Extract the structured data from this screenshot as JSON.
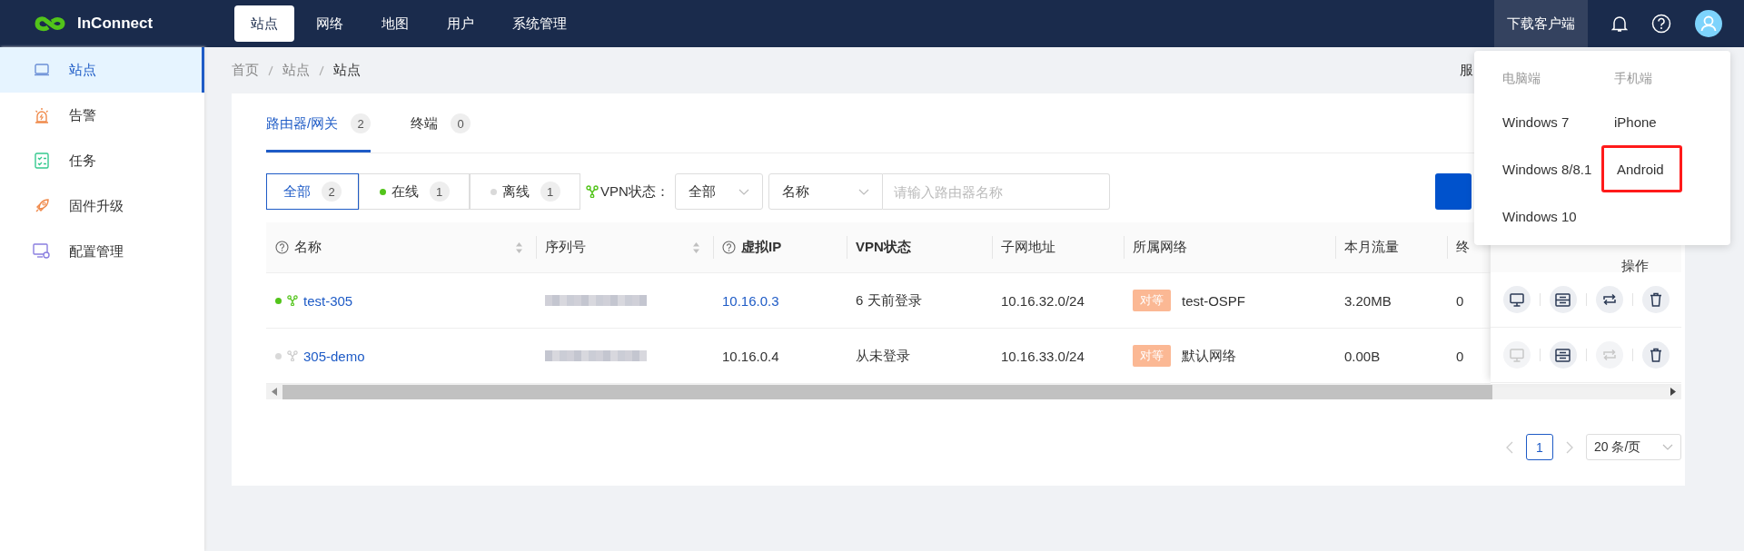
{
  "header": {
    "logo": "InConnect",
    "nav": [
      {
        "label": "站点",
        "selected": true
      },
      {
        "label": "网络",
        "selected": false
      },
      {
        "label": "地图",
        "selected": false
      },
      {
        "label": "用户",
        "selected": false
      },
      {
        "label": "系统管理",
        "selected": false
      }
    ],
    "download": "下载客户端"
  },
  "sidebar": {
    "items": [
      {
        "label": "站点",
        "selected": true
      },
      {
        "label": "告警",
        "selected": false
      },
      {
        "label": "任务",
        "selected": false
      },
      {
        "label": "固件升级",
        "selected": false
      },
      {
        "label": "配置管理",
        "selected": false
      }
    ]
  },
  "breadcrumb": [
    "首页",
    "站点",
    "站点"
  ],
  "breadcrumb_right": "服",
  "tabs": [
    {
      "label": "路由器/网关",
      "count": "2",
      "selected": true
    },
    {
      "label": "终端",
      "count": "0",
      "selected": false
    }
  ],
  "filters": [
    {
      "label": "全部",
      "count": "2",
      "selected": true
    },
    {
      "label": "在线",
      "count": "1",
      "selected": false,
      "color": "#52c41a"
    },
    {
      "label": "离线",
      "count": "1",
      "selected": false,
      "color": "#d9d9d9"
    }
  ],
  "vpn_filter": {
    "label": "VPN状态：",
    "value": "全部"
  },
  "field_select": "名称",
  "search": {
    "placeholder": "请输入路由器名称"
  },
  "table": {
    "columns": [
      {
        "label": "名称",
        "help": true,
        "sortable": true
      },
      {
        "label": "序列号",
        "help": false,
        "sortable": true
      },
      {
        "label": "虚拟IP",
        "help": true,
        "sortable": false
      },
      {
        "label": "VPN状态",
        "help": false,
        "sortable": false
      },
      {
        "label": "子网地址",
        "help": false,
        "sortable": false
      },
      {
        "label": "所属网络",
        "help": false,
        "sortable": false
      },
      {
        "label": "本月流量",
        "help": false,
        "sortable": false
      },
      {
        "label": "终",
        "help": false,
        "sortable": false
      }
    ],
    "action_column": "操作",
    "rows": [
      {
        "name": "test-305",
        "online": true,
        "ip": "10.16.0.3",
        "ip_linked": true,
        "vpn": "6 天前登录",
        "subnet": "10.16.32.0/24",
        "tag": "对等",
        "network": "test-OSPF",
        "traffic": "3.20MB",
        "terminals": "0",
        "actions": [
          {
            "kind": "remote",
            "disabled": false
          },
          {
            "kind": "config",
            "disabled": false
          },
          {
            "kind": "sync",
            "disabled": false
          },
          {
            "kind": "delete",
            "disabled": false
          }
        ]
      },
      {
        "name": "305-demo",
        "online": false,
        "ip": "10.16.0.4",
        "ip_linked": false,
        "vpn": "从未登录",
        "subnet": "10.16.33.0/24",
        "tag": "对等",
        "network": "默认网络",
        "traffic": "0.00B",
        "terminals": "0",
        "actions": [
          {
            "kind": "remote",
            "disabled": true
          },
          {
            "kind": "config",
            "disabled": false
          },
          {
            "kind": "sync",
            "disabled": true
          },
          {
            "kind": "delete",
            "disabled": false
          }
        ]
      }
    ]
  },
  "pagination": {
    "pages": [
      {
        "label": "1",
        "selected": true
      }
    ],
    "page_size": "20 条/页"
  },
  "download_menu": {
    "columns": [
      {
        "heading": "电脑端",
        "items": [
          {
            "label": "Windows 7",
            "highlighted": false
          },
          {
            "label": "Windows 8/8.1",
            "highlighted": false
          },
          {
            "label": "Windows 10",
            "highlighted": false
          }
        ]
      },
      {
        "heading": "手机端",
        "items": [
          {
            "label": "iPhone",
            "highlighted": false
          },
          {
            "label": "Android",
            "highlighted": true
          }
        ]
      }
    ]
  }
}
